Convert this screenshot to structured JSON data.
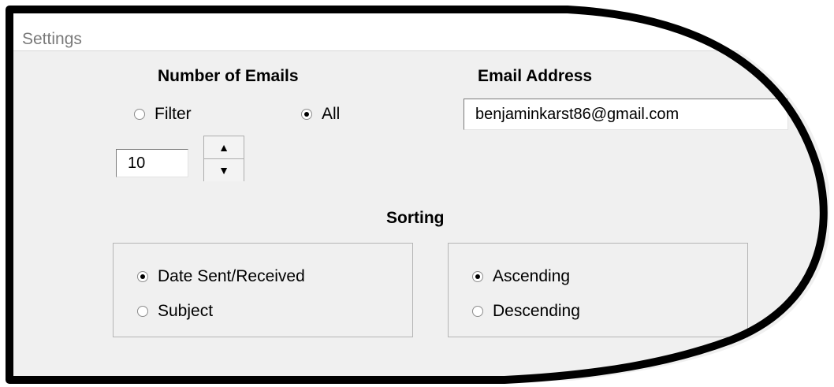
{
  "window": {
    "title": "Settings"
  },
  "number_of_emails": {
    "heading": "Number of Emails",
    "options": [
      {
        "label": "Filter",
        "selected": false
      },
      {
        "label": "All",
        "selected": true
      }
    ],
    "count_value": "10",
    "spin_up_icon": "triangle-up-icon",
    "spin_down_icon": "triangle-down-icon"
  },
  "email_address": {
    "heading": "Email Address",
    "value": "benjaminkarst86@gmail.com"
  },
  "sorting": {
    "heading": "Sorting",
    "sort_by": [
      {
        "label": "Date Sent/Received",
        "selected": true
      },
      {
        "label": "Subject",
        "selected": false
      }
    ],
    "order": [
      {
        "label": "Ascending",
        "selected": true
      },
      {
        "label": "Descending",
        "selected": false
      }
    ]
  },
  "colors": {
    "client_background": "#f0f0f0",
    "title_text": "#7a7a7a",
    "outline_stroke": "#000000"
  }
}
